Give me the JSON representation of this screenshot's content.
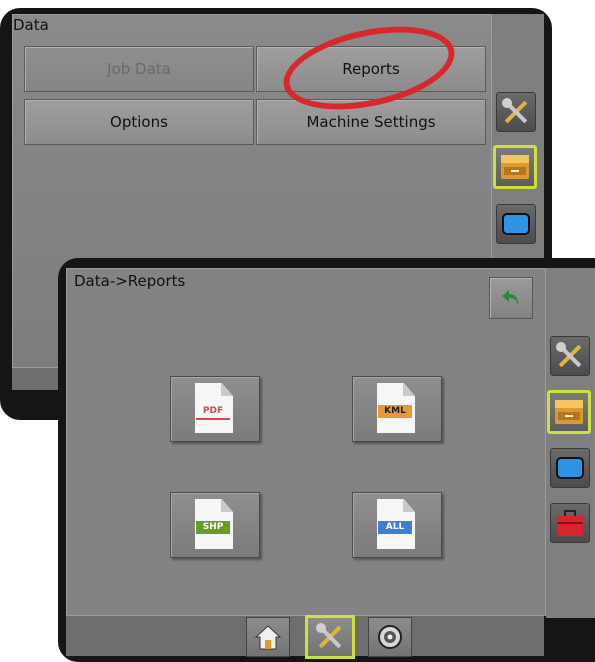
{
  "data_screen": {
    "title": "Data",
    "buttons": {
      "job_data": "Job Data",
      "reports": "Reports",
      "options": "Options",
      "machine_settings": "Machine Settings"
    }
  },
  "reports_screen": {
    "title": "Data->Reports",
    "formats": [
      "PDF",
      "KML",
      "SHP",
      "ALL"
    ]
  },
  "icons": {
    "sidebar": [
      "tools-icon",
      "file-cabinet-icon",
      "screen-icon",
      "toolbox-icon"
    ],
    "bottom_bar": [
      "home-icon",
      "tools-icon",
      "gps-icon"
    ],
    "back": "back-arrow-icon"
  },
  "colors": {
    "highlight": "#d8282e",
    "active_outline": "#cfe03c",
    "back_arrow": "#2a8a3c",
    "pdf_tag": "#d34a4a",
    "kml_tag": "#e49a3a",
    "shp_tag": "#6a9a2a",
    "all_tag": "#3f7fd0"
  }
}
